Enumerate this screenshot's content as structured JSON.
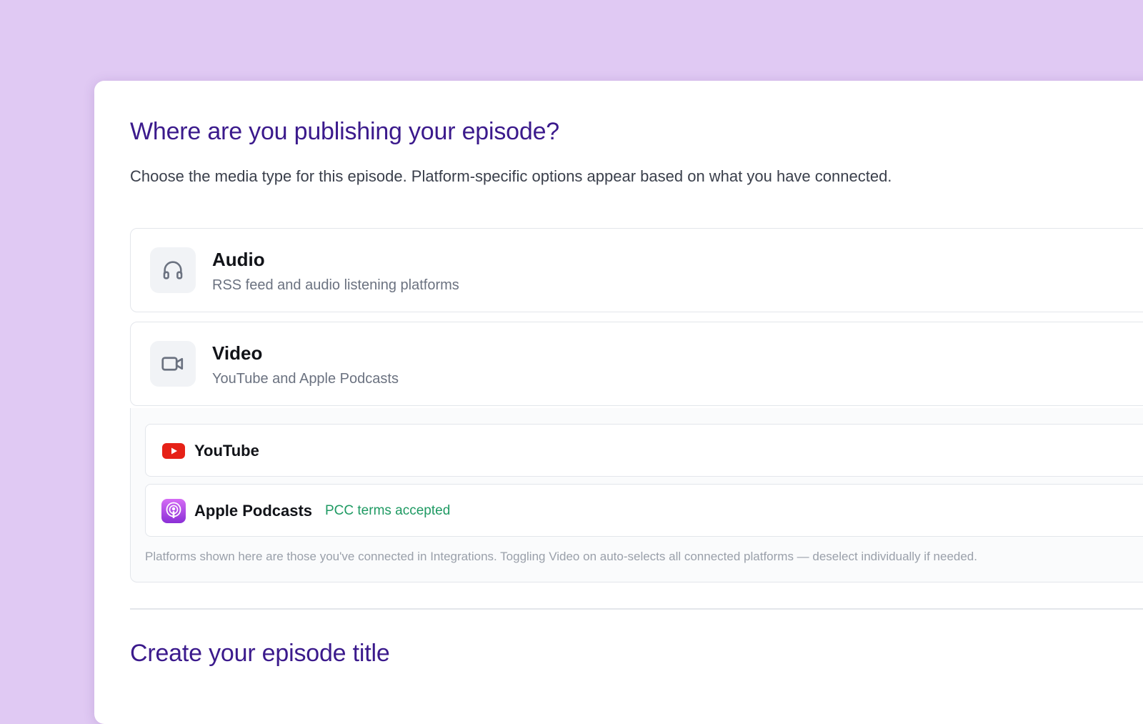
{
  "publish": {
    "heading": "Where are you publishing your episode?",
    "subtitle": "Choose the media type for this episode. Platform-specific options appear based on what you have connected.",
    "options": [
      {
        "title": "Audio",
        "description": "RSS feed and audio listening platforms",
        "icon": "headphones-icon"
      },
      {
        "title": "Video",
        "description": "YouTube and Apple Podcasts",
        "icon": "video-camera-icon"
      }
    ],
    "platforms": [
      {
        "name": "YouTube",
        "icon": "youtube-icon",
        "brand_color": "#e62117"
      },
      {
        "name": "Apple Podcasts",
        "icon": "apple-podcasts-icon",
        "badge": "PCC terms accepted",
        "brand_color": "#9b3fe0"
      }
    ],
    "note": "Platforms shown here are those you've connected in Integrations. Toggling Video on auto-selects all connected platforms — deselect individually if needed."
  },
  "title_section": {
    "heading": "Create your episode title"
  },
  "colors": {
    "background": "#e0c9f3",
    "heading": "#3b1a8c",
    "success": "#1f9a63"
  }
}
